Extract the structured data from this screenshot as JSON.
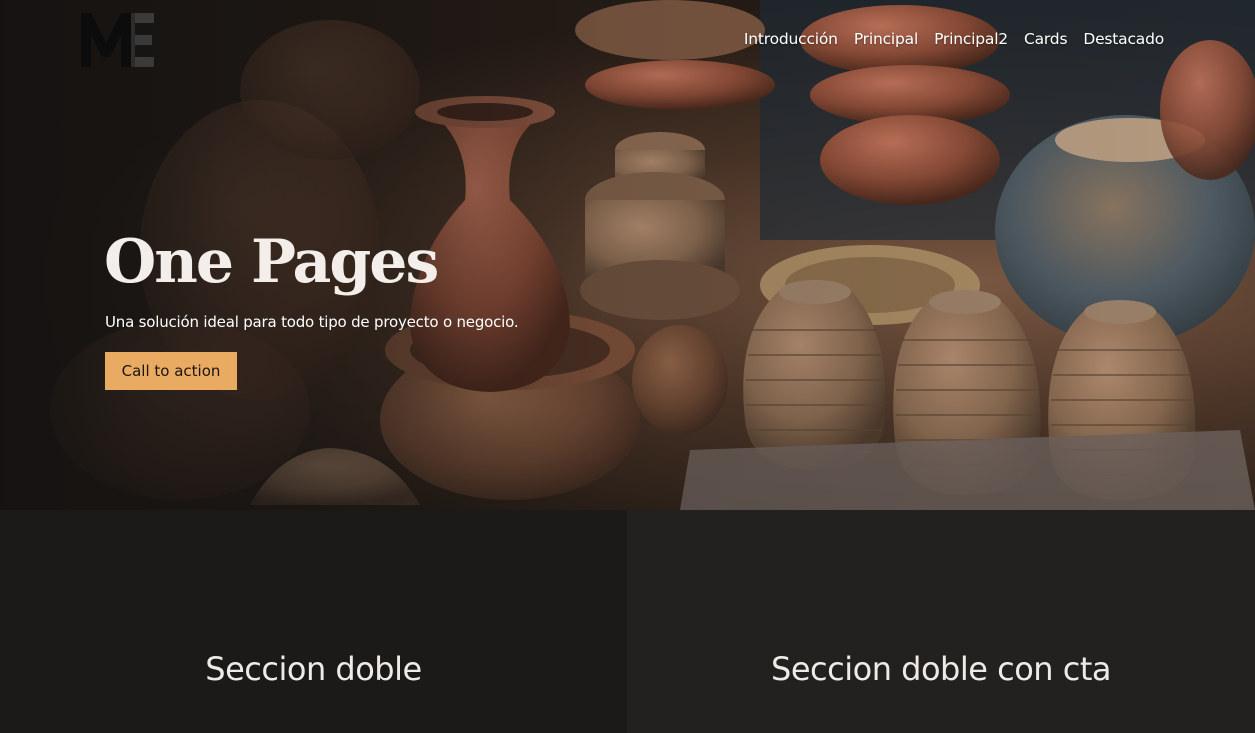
{
  "brand": {
    "logo_text": "ME",
    "colors": {
      "accent": "#e9ab62",
      "dark": "#1c1a19",
      "dark_alt": "#232120",
      "text": "#f3eee9"
    }
  },
  "nav": {
    "items": [
      {
        "label": "Introducción"
      },
      {
        "label": "Principal"
      },
      {
        "label": "Principal2"
      },
      {
        "label": "Cards"
      },
      {
        "label": "Destacado"
      }
    ]
  },
  "hero": {
    "title": "One Pages",
    "subtitle": "Una solución ideal para todo tipo de proyecto o negocio.",
    "cta_label": "Call to action"
  },
  "sections": {
    "left_title": "Seccion doble",
    "right_title": "Seccion doble con cta"
  }
}
